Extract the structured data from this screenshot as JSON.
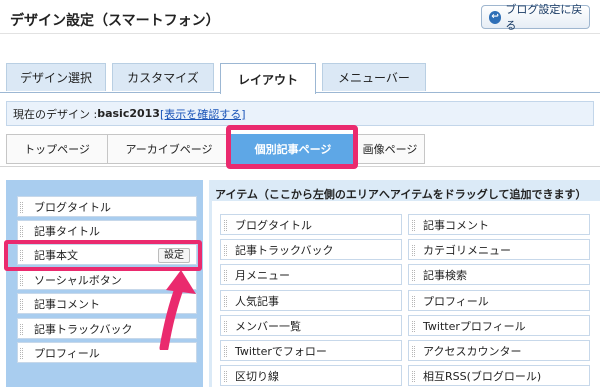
{
  "header": {
    "title": "デザイン設定（スマートフォン）",
    "back_button": "ブログ設定に戻る"
  },
  "tabs": [
    {
      "label": "デザイン選択",
      "active": false
    },
    {
      "label": "カスタマイズ",
      "active": false
    },
    {
      "label": "レイアウト",
      "active": true
    },
    {
      "label": "メニューバー",
      "active": false
    }
  ],
  "design_bar": {
    "prefix": "現在のデザイン : ",
    "design_name": "basic2013",
    "link": "[表示を確認する]"
  },
  "subtabs": [
    {
      "label": "トップページ",
      "active": false
    },
    {
      "label": "アーカイブページ",
      "active": false
    },
    {
      "label": "個別記事ページ",
      "active": true
    },
    {
      "label": "画像ページ",
      "active": false
    }
  ],
  "left_items": [
    {
      "label": "ブログタイトル"
    },
    {
      "label": "記事タイトル"
    },
    {
      "label": "記事本文",
      "button": "設定"
    },
    {
      "label": "ソーシャルボタン"
    },
    {
      "label": "記事コメント"
    },
    {
      "label": "記事トラックバック"
    },
    {
      "label": "プロフィール"
    }
  ],
  "right_panel": {
    "heading": "アイテム（ここから左側のエリアへアイテムをドラッグして追加できます）",
    "items": [
      {
        "label": "ブログタイトル"
      },
      {
        "label": "記事コメント"
      },
      {
        "label": "記事トラックバック"
      },
      {
        "label": "カテゴリメニュー"
      },
      {
        "label": "月メニュー"
      },
      {
        "label": "記事検索"
      },
      {
        "label": "人気記事"
      },
      {
        "label": "プロフィール"
      },
      {
        "label": "メンバー一覧"
      },
      {
        "label": "Twitterプロフィール"
      },
      {
        "label": "Twitterでフォロー"
      },
      {
        "label": "アクセスカウンター"
      },
      {
        "label": "区切り線"
      },
      {
        "label": "相互RSS(ブログロール)"
      }
    ]
  },
  "colors": {
    "highlight": "#ea2a6e",
    "active_subtab": "#5ea7e6",
    "left_panel_bg": "#a9cdef",
    "link": "#1a54b8"
  }
}
